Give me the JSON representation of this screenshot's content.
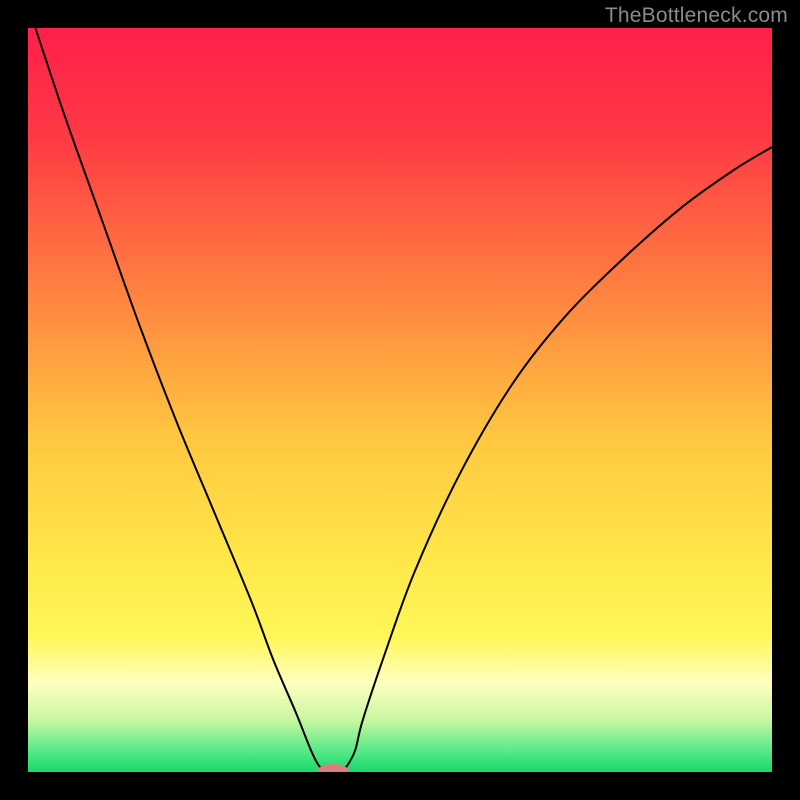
{
  "watermark": "TheBottleneck.com",
  "chart_data": {
    "type": "line",
    "title": "",
    "xlabel": "",
    "ylabel": "",
    "xlim": [
      0,
      100
    ],
    "ylim": [
      0,
      100
    ],
    "background_gradient": {
      "stops": [
        {
          "offset": 0.0,
          "color": "#ff1f4b"
        },
        {
          "offset": 0.15,
          "color": "#ff3a44"
        },
        {
          "offset": 0.35,
          "color": "#ff8040"
        },
        {
          "offset": 0.55,
          "color": "#ffc740"
        },
        {
          "offset": 0.72,
          "color": "#ffe84a"
        },
        {
          "offset": 0.82,
          "color": "#fff75a"
        },
        {
          "offset": 0.88,
          "color": "#ffffc0"
        },
        {
          "offset": 0.93,
          "color": "#c8f7a0"
        },
        {
          "offset": 0.97,
          "color": "#5bea8a"
        },
        {
          "offset": 1.0,
          "color": "#17d96b"
        }
      ]
    },
    "series": [
      {
        "name": "bottleneck-curve",
        "color": "#000000",
        "x": [
          1,
          5,
          10,
          15,
          20,
          25,
          30,
          33,
          36,
          38,
          39,
          40,
          41,
          42,
          43,
          44,
          45,
          48,
          52,
          58,
          65,
          72,
          80,
          88,
          95,
          100
        ],
        "y": [
          100,
          88,
          74,
          60,
          47,
          35,
          23,
          15,
          8,
          3,
          1,
          0,
          0,
          0,
          1,
          3,
          7,
          16,
          27,
          40,
          52,
          61,
          69,
          76,
          81,
          84
        ]
      }
    ],
    "marker": {
      "name": "bottleneck-point",
      "x": 41,
      "y": 0,
      "color": "#d97f7f",
      "rx": 2.2,
      "ry": 1.1
    }
  }
}
